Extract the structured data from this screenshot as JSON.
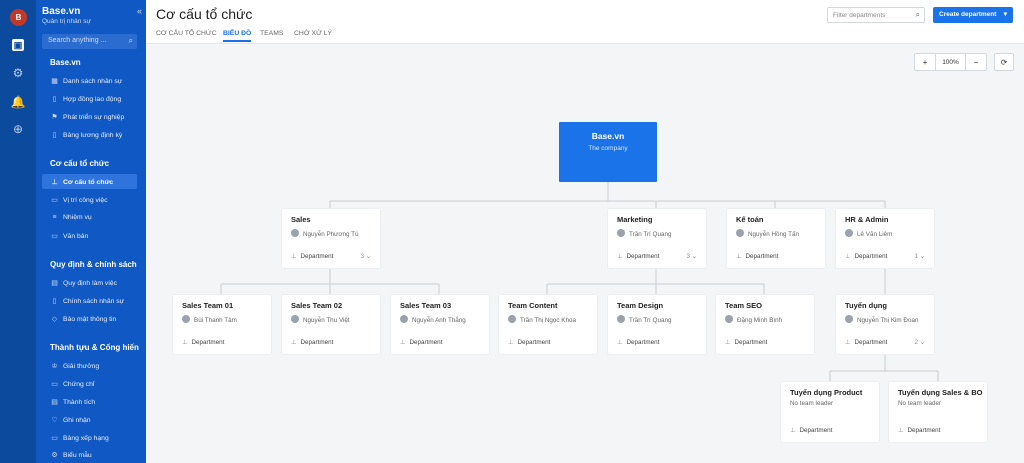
{
  "app": {
    "name": "Base.vn",
    "subtitle": "Quản trị nhân sự",
    "avatar_initial": "B"
  },
  "rail_icons": [
    "home-icon",
    "gear-icon",
    "bell-icon",
    "plus-circle-icon"
  ],
  "search": {
    "placeholder": "Search anything ..."
  },
  "sidebar": {
    "group1": {
      "title": "Base.vn",
      "items": [
        "Danh sách nhân sự",
        "Hợp đồng lao động",
        "Phát triển sự nghiệp",
        "Bảng lương định kỳ"
      ]
    },
    "group2": {
      "title": "Cơ cấu tổ chức",
      "items": [
        "Cơ cấu tổ chức",
        "Vị trí công việc",
        "Nhiệm vụ",
        "Văn bản"
      ]
    },
    "group3": {
      "title": "Quy định & chính sách",
      "items": [
        "Quy định làm việc",
        "Chính sách nhân sự",
        "Bảo mật thông tin"
      ]
    },
    "group4": {
      "title": "Thành tựu & Cống hiến",
      "items": [
        "Giải thưởng",
        "Chứng chỉ",
        "Thành tích",
        "Ghi nhận",
        "Bảng xếp hạng",
        "Biểu mẫu"
      ]
    }
  },
  "header": {
    "title": "Cơ cấu tổ chức",
    "tabs": [
      "CƠ CẤU TỔ CHỨC",
      "BIỂU ĐỒ",
      "TEAMS",
      "CHỜ XỬ LÝ"
    ],
    "active_tab": "BIỂU ĐỒ",
    "filter_placeholder": "Filter departments",
    "create_label": "Create department"
  },
  "zoom": {
    "plus": "+",
    "level": "100%",
    "minus": "−",
    "refresh": "⟳"
  },
  "root": {
    "name": "Base.vn",
    "subtitle": "The company"
  },
  "dept_label": "Department",
  "no_leader": "No team leader",
  "departments": [
    {
      "name": "Sales",
      "leader": "Nguyễn Phương Tú",
      "count": "3"
    },
    {
      "name": "Marketing",
      "leader": "Trần Trí Quang",
      "count": "3"
    },
    {
      "name": "Kế toán",
      "leader": "Nguyễn Hồng Tấn",
      "count": ""
    },
    {
      "name": "HR & Admin",
      "leader": "Lê Văn Liêm",
      "count": "1"
    },
    {
      "name": "Sales Team 01",
      "leader": "Bùi Thanh Tâm",
      "count": ""
    },
    {
      "name": "Sales Team 02",
      "leader": "Nguyễn Thu Việt",
      "count": ""
    },
    {
      "name": "Sales Team 03",
      "leader": "Nguyễn Anh Thắng",
      "count": ""
    },
    {
      "name": "Team Content",
      "leader": "Trần Thị Ngọc Khoa",
      "count": ""
    },
    {
      "name": "Team Design",
      "leader": "Trần Trí Quang",
      "count": ""
    },
    {
      "name": "Team SEO",
      "leader": "Đặng Minh Bình",
      "count": ""
    },
    {
      "name": "Tuyển dụng",
      "leader": "Nguyễn Thị Kim Đoan",
      "count": "2"
    },
    {
      "name": "Tuyển dụng Product",
      "leader": "No team leader",
      "count": ""
    },
    {
      "name": "Tuyển dụng Sales & BO",
      "leader": "No team leader",
      "count": ""
    }
  ]
}
